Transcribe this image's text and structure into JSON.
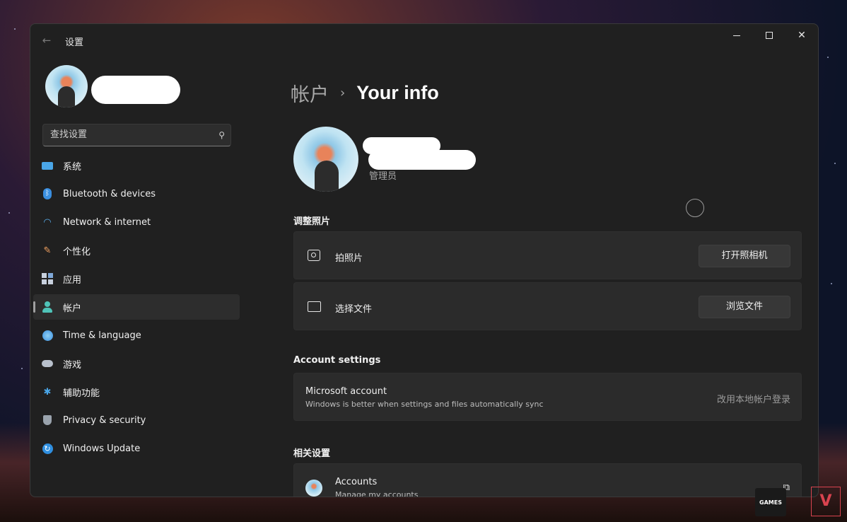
{
  "window": {
    "app_title": "设置"
  },
  "sidebar": {
    "search_placeholder": "查找设置",
    "items": [
      {
        "label": "系统",
        "icon": "display-icon",
        "active": false
      },
      {
        "label": "Bluetooth & devices",
        "icon": "bluetooth-icon",
        "active": false
      },
      {
        "label": "Network & internet",
        "icon": "wifi-icon",
        "active": false
      },
      {
        "label": "个性化",
        "icon": "brush-icon",
        "active": false
      },
      {
        "label": "应用",
        "icon": "apps-icon",
        "active": false
      },
      {
        "label": "帐户",
        "icon": "person-icon",
        "active": true
      },
      {
        "label": "Time & language",
        "icon": "globe-clock-icon",
        "active": false
      },
      {
        "label": "游戏",
        "icon": "gamepad-icon",
        "active": false
      },
      {
        "label": "辅助功能",
        "icon": "accessibility-icon",
        "active": false
      },
      {
        "label": "Privacy & security",
        "icon": "shield-icon",
        "active": false
      },
      {
        "label": "Windows Update",
        "icon": "update-icon",
        "active": false
      }
    ]
  },
  "main": {
    "breadcrumb_parent": "帐户",
    "breadcrumb_current": "Your info",
    "role": "管理员",
    "adjust_photo": {
      "title": "调整照片",
      "take_photo_label": "拍照片",
      "take_photo_button": "打开照相机",
      "choose_file_label": "选择文件",
      "choose_file_button": "浏览文件"
    },
    "account_settings": {
      "title": "Account settings",
      "ms_title": "Microsoft account",
      "ms_sub": "Windows is better when settings and files automatically sync",
      "ms_link": "改用本地帐户登录"
    },
    "related": {
      "title": "相关设置",
      "accounts_title": "Accounts",
      "accounts_sub": "Manage my accounts"
    }
  },
  "taskbar_icons": {
    "epic_text": "GAMES",
    "valorant_text": "V"
  },
  "colors": {
    "window_bg": "#202020",
    "card_bg": "#2b2b2b",
    "active_item_bg": "#2d2d2d",
    "accent_bluetooth": "#3a8fe0",
    "accent_person": "#4fc3b8"
  }
}
